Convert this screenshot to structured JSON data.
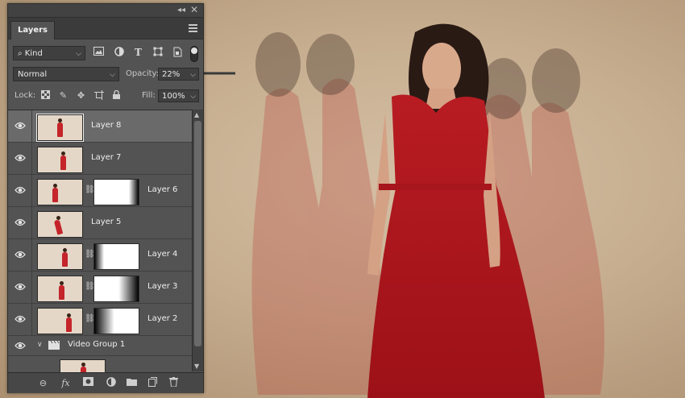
{
  "panel": {
    "tab_label": "Layers",
    "filter_kind": "Kind",
    "blend_mode": "Normal",
    "opacity_label": "Opacity:",
    "opacity_value": "22%",
    "lock_label": "Lock:",
    "fill_label": "Fill:",
    "fill_value": "100%"
  },
  "layers": [
    {
      "name": "Layer 8",
      "visible": true,
      "selected": true,
      "has_mask": false
    },
    {
      "name": "Layer 7",
      "visible": true,
      "selected": false,
      "has_mask": false
    },
    {
      "name": "Layer 6",
      "visible": true,
      "selected": false,
      "has_mask": true
    },
    {
      "name": "Layer 5",
      "visible": true,
      "selected": false,
      "has_mask": false
    },
    {
      "name": "Layer 4",
      "visible": true,
      "selected": false,
      "has_mask": true
    },
    {
      "name": "Layer 3",
      "visible": true,
      "selected": false,
      "has_mask": true
    },
    {
      "name": "Layer 2",
      "visible": true,
      "selected": false,
      "has_mask": true
    }
  ],
  "group": {
    "name": "Video Group 1",
    "visible": true
  },
  "icons": {
    "filter": [
      "image-filter-icon",
      "adjustment-filter-icon",
      "type-filter-icon",
      "shape-filter-icon",
      "smart-object-filter-icon"
    ],
    "lock": [
      "lock-transparent-pixels-icon",
      "lock-image-pixels-icon",
      "lock-position-icon",
      "lock-artboard-icon",
      "lock-all-icon"
    ],
    "bottom": [
      "link-layers-icon",
      "fx-icon",
      "add-mask-icon",
      "new-adjustment-icon",
      "new-group-icon",
      "new-layer-icon",
      "delete-layer-icon"
    ]
  },
  "colors": {
    "panel_bg": "#535353",
    "selected_row": "#6a6a6a",
    "dress_red": "#c4242a",
    "backdrop": "#c7ae90"
  }
}
